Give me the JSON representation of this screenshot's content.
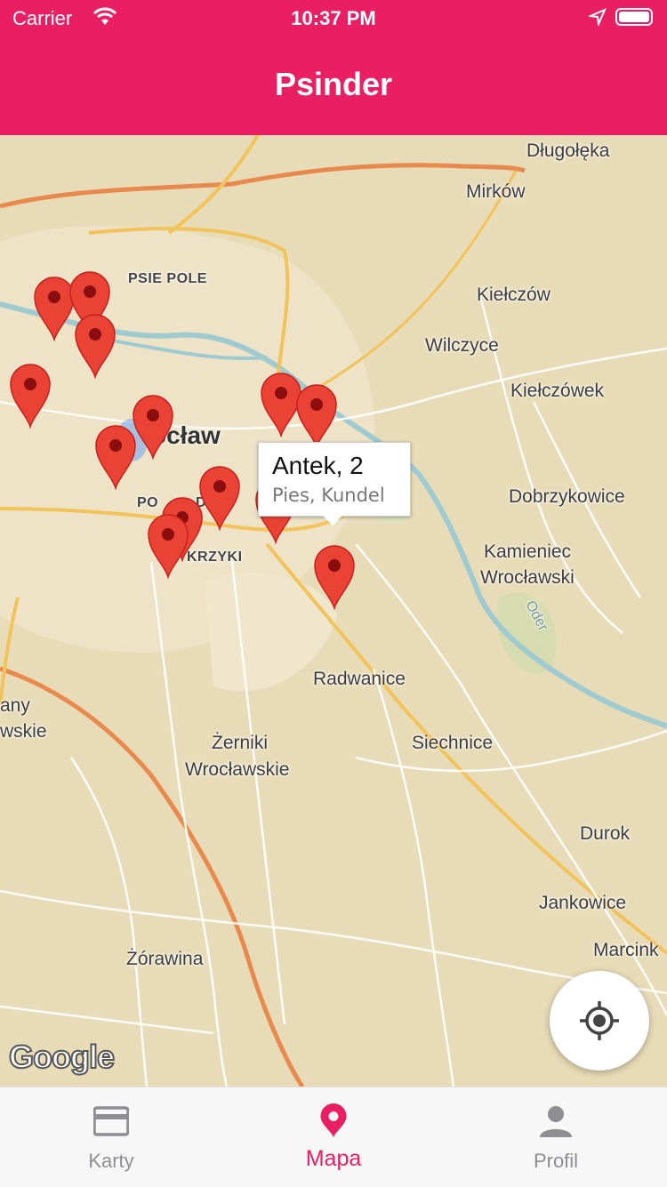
{
  "status_bar": {
    "carrier": "Carrier",
    "time": "10:37 PM"
  },
  "header": {
    "title": "Psinder"
  },
  "map": {
    "places": {
      "dlugoleka": "Długołęka",
      "mirkow": "Mirków",
      "psie_pole": "PSIE POLE",
      "kielczow": "Kiełczów",
      "wilczyce": "Wilczyce",
      "kielczowek": "Kiełczówek",
      "wroclaw": "ocław",
      "dobrzykowice": "Dobrzykowice",
      "kamieniec_1": "Kamieniec",
      "kamieniec_2": "Wrocławski",
      "poludnie": "PO",
      "poludnie_2": "DNIE",
      "krzyki": "KRZYKI",
      "oder": "Oder",
      "radwanice": "Radwanice",
      "kobierzyce_1": "any",
      "kobierzyce_2": "wskie",
      "zerniki_1": "Żerniki",
      "zerniki_2": "Wrocławskie",
      "siechnice": "Siechnice",
      "durok": "Durok",
      "jankowice": "Jankowice",
      "marcinkowice": "Marcink",
      "zorawina": "Żórawina"
    },
    "callout": {
      "name": "Antek, 2",
      "subtitle": "Pies, Kundel"
    },
    "logo": "Google"
  },
  "tabs": [
    {
      "label": "Karty",
      "icon": "card-icon",
      "active": false
    },
    {
      "label": "Mapa",
      "icon": "map-pin-icon",
      "active": true
    },
    {
      "label": "Profil",
      "icon": "person-icon",
      "active": false
    }
  ],
  "colors": {
    "accent": "#e91e63",
    "pin": "#ea4335",
    "map_bg": "#e8dcb8"
  }
}
